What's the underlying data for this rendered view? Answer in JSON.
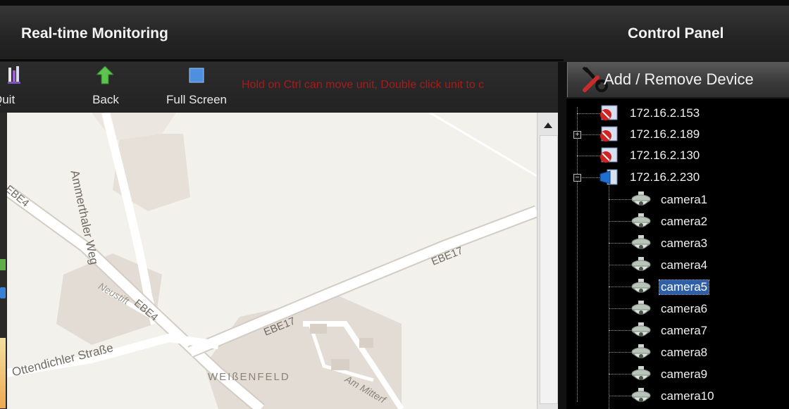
{
  "header": {
    "left_title": "Real-time Monitoring",
    "right_title": "Control Panel"
  },
  "toolbar": {
    "quit_label": "Quit",
    "back_label": "Back",
    "fullscreen_label": "Full Screen",
    "hint": "Hold on Ctrl can move unit, Double click unit to c"
  },
  "map": {
    "labels": {
      "ammerthaler": "Ammerthaler Weg",
      "ebe4_top": "EBE4",
      "ebe4_mid": "EBE4",
      "ebe17_right": "EBE17",
      "ebe17_mid": "EBE17",
      "neustift": "Neustift",
      "ottendichler": "Ottendichler Straße",
      "weissenfeld": "WEIßENFELD",
      "am_mitter": "Am Mitterf"
    }
  },
  "control_panel": {
    "add_remove_label": "Add / Remove Device"
  },
  "tree": {
    "devices": [
      {
        "ip": "172.16.2.153",
        "status": "offline"
      },
      {
        "ip": "172.16.2.189",
        "status": "offline",
        "collapsed": true
      },
      {
        "ip": "172.16.2.130",
        "status": "offline"
      },
      {
        "ip": "172.16.2.230",
        "status": "online",
        "expanded": true
      }
    ],
    "cameras": [
      "camera1",
      "camera2",
      "camera3",
      "camera4",
      "camera5",
      "camera6",
      "camera7",
      "camera8",
      "camera9",
      "camera10"
    ],
    "selected_camera": "camera5"
  },
  "colors": {
    "hint_text": "#a61b1b",
    "selection": "#2f5fa8",
    "back_arrow": "#5dc34f",
    "fullscreen_square": "#4f8fe0"
  }
}
